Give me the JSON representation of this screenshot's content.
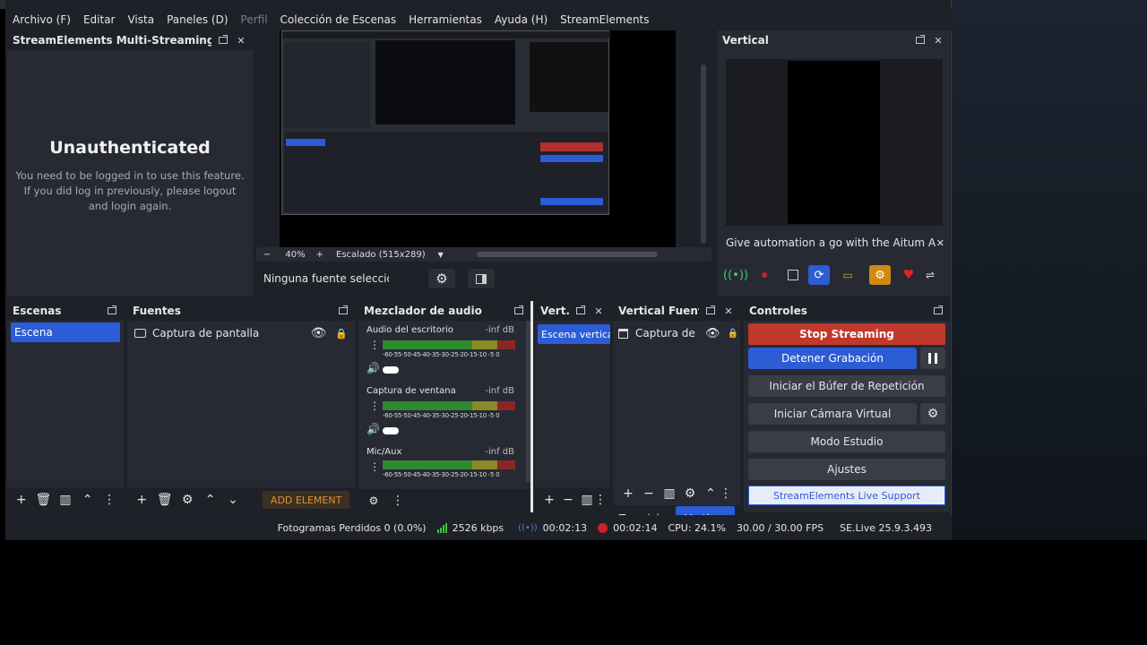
{
  "menu": {
    "items": [
      "Archivo (F)",
      "Editar",
      "Vista",
      "Paneles (D)",
      "Perfil",
      "Colección de Escenas",
      "Herramientas",
      "Ayuda (H)",
      "StreamElements"
    ]
  },
  "multistream": {
    "title": "StreamElements Multi-Streaming",
    "heading": "Unauthenticated",
    "message_line1": "You need to be logged in to use this feature.",
    "message_line2": "If you did log in previously, please logout",
    "message_line3": "and login again."
  },
  "preview": {
    "zoom": "40%",
    "scale_label": "Escalado (515x289)",
    "no_source": "Ninguna fuente seleccionac"
  },
  "vertical": {
    "title": "Vertical",
    "banner_text": "Give automation a go with the Aitum App"
  },
  "scenes": {
    "title": "Escenas",
    "items": [
      "Escena"
    ]
  },
  "sources": {
    "title": "Fuentes",
    "items": [
      "Captura de pantalla"
    ],
    "add_element": "ADD ELEMENT"
  },
  "mixer": {
    "title": "Mezclador de audio",
    "channels": [
      {
        "name": "Audio del escritorio",
        "level": "-inf dB"
      },
      {
        "name": "Captura de ventana",
        "level": "-inf dB"
      },
      {
        "name": "Mic/Aux",
        "level": "-inf dB"
      }
    ],
    "ticks": "-60-55-50-45-40-35-30-25-20-15-10 -5 0"
  },
  "vert_scenes": {
    "title": "Vert...",
    "items": [
      "Escena vertical"
    ]
  },
  "vert_sources": {
    "title": "Vertical Fuentes",
    "items": [
      "Captura de"
    ],
    "tab1": "Transici...",
    "tab2": "Vertic..."
  },
  "controls": {
    "title": "Controles",
    "stop_streaming": "Stop Streaming",
    "stop_recording": "Detener Grabación",
    "replay_buffer": "Iniciar el Búfer de Repetición",
    "virtual_cam": "Iniciar Cámara Virtual",
    "studio_mode": "Modo Estudio",
    "settings": "Ajustes",
    "live_support": "StreamElements Live Support"
  },
  "status": {
    "dropped": "Fotogramas Perdidos 0 (0.0%)",
    "bitrate": "2526 kbps",
    "stream_time": "00:02:13",
    "rec_time": "00:02:14",
    "cpu": "CPU: 24.1%",
    "fps": "30.00 / 30.00 FPS",
    "version": "SE.Live 25.9.3.493"
  },
  "colors": {
    "accent": "#2c5cd6",
    "stop_red": "#c0392b",
    "rec_red": "#d0202a"
  }
}
